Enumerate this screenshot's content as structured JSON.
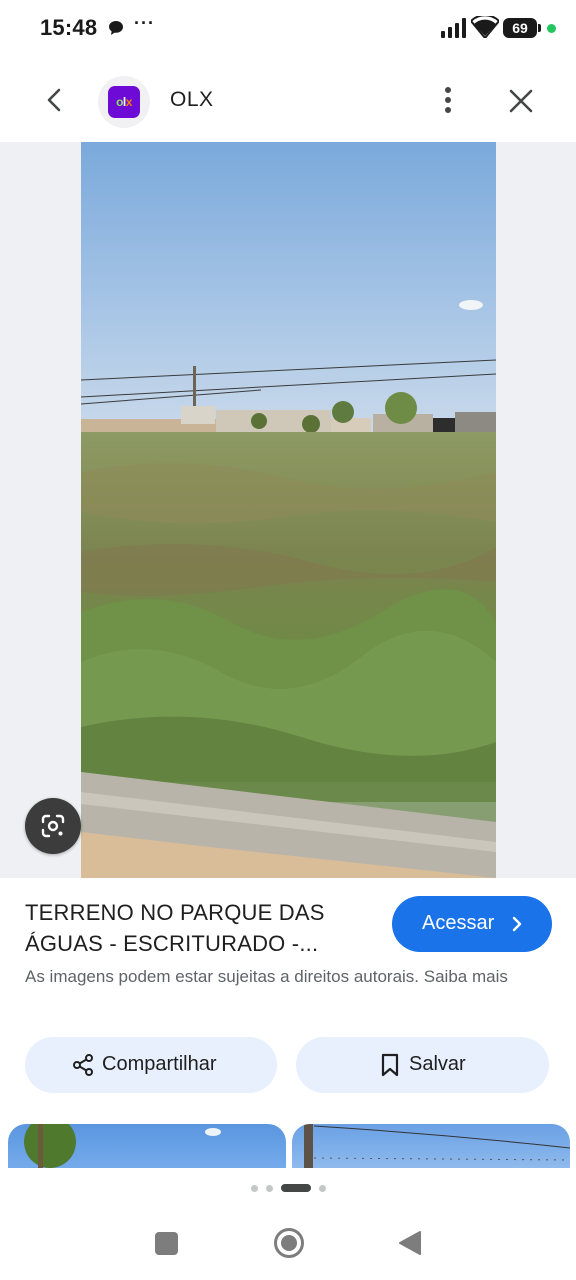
{
  "status_bar": {
    "time": "15:48",
    "dots": "···",
    "battery": "69"
  },
  "header": {
    "site_logo_text": "OLX",
    "site_name": "OLX"
  },
  "result": {
    "title": "TERRENO NO PARQUE DAS ÁGUAS - ESCRITURADO -...",
    "access_label": "Acessar",
    "copyright_text": "As imagens podem estar sujeitas a direitos autorais.",
    "learn_more": "Saiba mais",
    "share_label": "Compartilhar",
    "save_label": "Salvar"
  },
  "pager": {
    "count": 4,
    "active": 2
  },
  "colors": {
    "accent": "#1a73e8",
    "pill_bg": "#e8f0fe",
    "olx_purple": "#6e0ad6",
    "olx_orange": "#f28000"
  }
}
